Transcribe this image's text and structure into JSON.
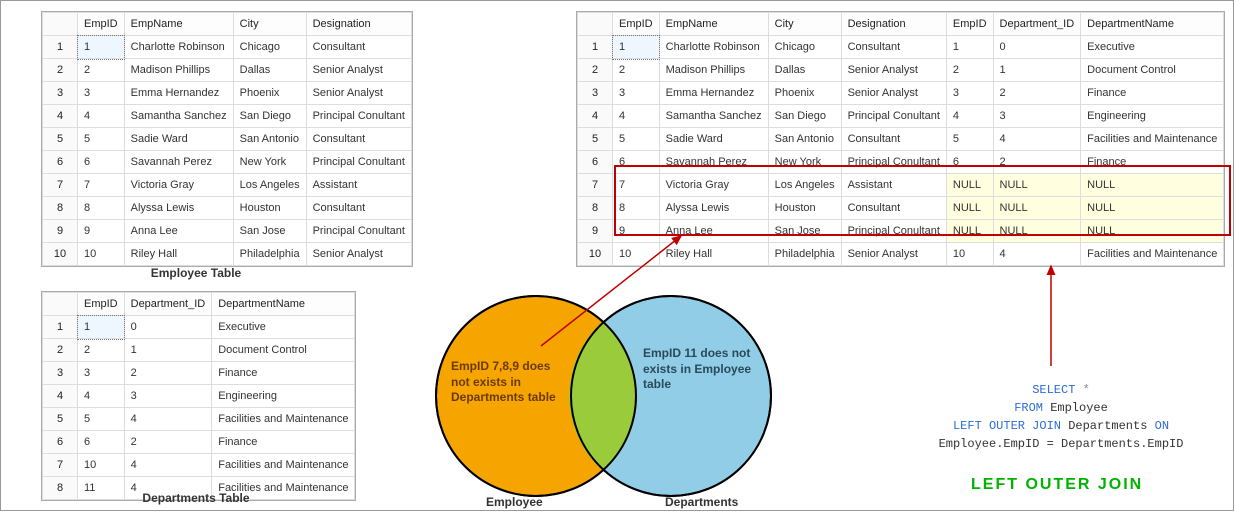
{
  "employee_table": {
    "caption": "Employee Table",
    "columns": [
      "EmpID",
      "EmpName",
      "City",
      "Designation"
    ],
    "rows": [
      {
        "n": "1",
        "EmpID": "1",
        "EmpName": "Charlotte Robinson",
        "City": "Chicago",
        "Designation": "Consultant"
      },
      {
        "n": "2",
        "EmpID": "2",
        "EmpName": "Madison Phillips",
        "City": "Dallas",
        "Designation": "Senior Analyst"
      },
      {
        "n": "3",
        "EmpID": "3",
        "EmpName": "Emma Hernandez",
        "City": "Phoenix",
        "Designation": "Senior Analyst"
      },
      {
        "n": "4",
        "EmpID": "4",
        "EmpName": "Samantha Sanchez",
        "City": "San Diego",
        "Designation": "Principal Conultant"
      },
      {
        "n": "5",
        "EmpID": "5",
        "EmpName": "Sadie Ward",
        "City": "San Antonio",
        "Designation": "Consultant"
      },
      {
        "n": "6",
        "EmpID": "6",
        "EmpName": "Savannah Perez",
        "City": "New York",
        "Designation": "Principal Conultant"
      },
      {
        "n": "7",
        "EmpID": "7",
        "EmpName": "Victoria Gray",
        "City": "Los Angeles",
        "Designation": "Assistant"
      },
      {
        "n": "8",
        "EmpID": "8",
        "EmpName": "Alyssa Lewis",
        "City": "Houston",
        "Designation": "Consultant"
      },
      {
        "n": "9",
        "EmpID": "9",
        "EmpName": "Anna Lee",
        "City": "San Jose",
        "Designation": "Principal Conultant"
      },
      {
        "n": "10",
        "EmpID": "10",
        "EmpName": "Riley Hall",
        "City": "Philadelphia",
        "Designation": "Senior Analyst"
      }
    ]
  },
  "departments_table": {
    "caption": "Departments Table",
    "columns": [
      "EmpID",
      "Department_ID",
      "DepartmentName"
    ],
    "rows": [
      {
        "n": "1",
        "EmpID": "1",
        "Department_ID": "0",
        "DepartmentName": "Executive"
      },
      {
        "n": "2",
        "EmpID": "2",
        "Department_ID": "1",
        "DepartmentName": "Document Control"
      },
      {
        "n": "3",
        "EmpID": "3",
        "Department_ID": "2",
        "DepartmentName": "Finance"
      },
      {
        "n": "4",
        "EmpID": "4",
        "Department_ID": "3",
        "DepartmentName": "Engineering"
      },
      {
        "n": "5",
        "EmpID": "5",
        "Department_ID": "4",
        "DepartmentName": "Facilities and Maintenance"
      },
      {
        "n": "6",
        "EmpID": "6",
        "Department_ID": "2",
        "DepartmentName": "Finance"
      },
      {
        "n": "7",
        "EmpID": "10",
        "Department_ID": "4",
        "DepartmentName": "Facilities and Maintenance"
      },
      {
        "n": "8",
        "EmpID": "11",
        "Department_ID": "4",
        "DepartmentName": "Facilities and Maintenance"
      }
    ]
  },
  "result_table": {
    "columns": [
      "EmpID",
      "EmpName",
      "City",
      "Designation",
      "EmpID",
      "Department_ID",
      "DepartmentName"
    ],
    "rows": [
      {
        "n": "1",
        "c": [
          "1",
          "Charlotte Robinson",
          "Chicago",
          "Consultant",
          "1",
          "0",
          "Executive"
        ],
        "null": false
      },
      {
        "n": "2",
        "c": [
          "2",
          "Madison Phillips",
          "Dallas",
          "Senior Analyst",
          "2",
          "1",
          "Document Control"
        ],
        "null": false
      },
      {
        "n": "3",
        "c": [
          "3",
          "Emma Hernandez",
          "Phoenix",
          "Senior Analyst",
          "3",
          "2",
          "Finance"
        ],
        "null": false
      },
      {
        "n": "4",
        "c": [
          "4",
          "Samantha Sanchez",
          "San Diego",
          "Principal Conultant",
          "4",
          "3",
          "Engineering"
        ],
        "null": false
      },
      {
        "n": "5",
        "c": [
          "5",
          "Sadie Ward",
          "San Antonio",
          "Consultant",
          "5",
          "4",
          "Facilities and Maintenance"
        ],
        "null": false
      },
      {
        "n": "6",
        "c": [
          "6",
          "Savannah Perez",
          "New York",
          "Principal Conultant",
          "6",
          "2",
          "Finance"
        ],
        "null": false
      },
      {
        "n": "7",
        "c": [
          "7",
          "Victoria Gray",
          "Los Angeles",
          "Assistant",
          "NULL",
          "NULL",
          "NULL"
        ],
        "null": true
      },
      {
        "n": "8",
        "c": [
          "8",
          "Alyssa Lewis",
          "Houston",
          "Consultant",
          "NULL",
          "NULL",
          "NULL"
        ],
        "null": true
      },
      {
        "n": "9",
        "c": [
          "9",
          "Anna Lee",
          "San Jose",
          "Principal Conultant",
          "NULL",
          "NULL",
          "NULL"
        ],
        "null": true
      },
      {
        "n": "10",
        "c": [
          "10",
          "Riley Hall",
          "Philadelphia",
          "Senior Analyst",
          "10",
          "4",
          "Facilities and Maintenance"
        ],
        "null": false
      }
    ]
  },
  "venn": {
    "left_label": "Employee",
    "right_label": "Departments",
    "left_text": "EmpID 7,8,9 does not exists in Departments table",
    "right_text": "EmpID 11 does not exists in Employee table"
  },
  "sql": {
    "line1_kw": "SELECT",
    "line1_rest": " *",
    "line2_kw": "FROM",
    "line2_id": " Employee",
    "line3_kw1": "LEFT OUTER JOIN",
    "line3_id": " Departments ",
    "line3_kw2": "ON",
    "line4": "Employee.EmpID = Departments.EmpID"
  },
  "title": "LEFT OUTER JOIN"
}
